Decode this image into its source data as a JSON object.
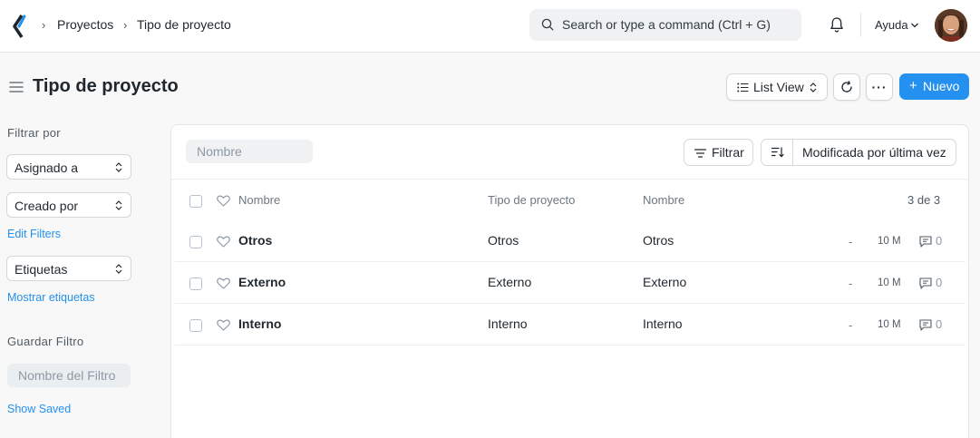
{
  "navbar": {
    "breadcrumbs": [
      "Proyectos",
      "Tipo de proyecto"
    ],
    "search_placeholder": "Search or type a command (Ctrl + G)",
    "help_label": "Ayuda"
  },
  "page": {
    "title": "Tipo de proyecto",
    "view_label": "List View",
    "more_label": "···",
    "new_label": "Nuevo",
    "new_plus": "+",
    "accent_color": "#2490ef"
  },
  "sidebar": {
    "filter_heading": "Filtrar por",
    "filters": [
      "Asignado a",
      "Creado por"
    ],
    "edit_filters_link": "Edit Filters",
    "tags_label": "Etiquetas",
    "show_tags_link": "Mostrar etiquetas",
    "save_filter_heading": "Guardar Filtro",
    "filter_name_placeholder": "Nombre del Filtro",
    "show_saved_link": "Show Saved"
  },
  "list": {
    "name_filter_placeholder": "Nombre",
    "filter_button": "Filtrar",
    "sort_label": "Modificada por última vez",
    "columns": [
      "Nombre",
      "Tipo de proyecto",
      "Nombre"
    ],
    "count_label": "3 de 3",
    "rows": [
      {
        "name": "Otros",
        "project_type": "Otros",
        "nombre": "Otros",
        "dash": "-",
        "modified": "10 M",
        "comments": "0"
      },
      {
        "name": "Externo",
        "project_type": "Externo",
        "nombre": "Externo",
        "dash": "-",
        "modified": "10 M",
        "comments": "0"
      },
      {
        "name": "Interno",
        "project_type": "Interno",
        "nombre": "Interno",
        "dash": "-",
        "modified": "10 M",
        "comments": "0"
      }
    ]
  }
}
